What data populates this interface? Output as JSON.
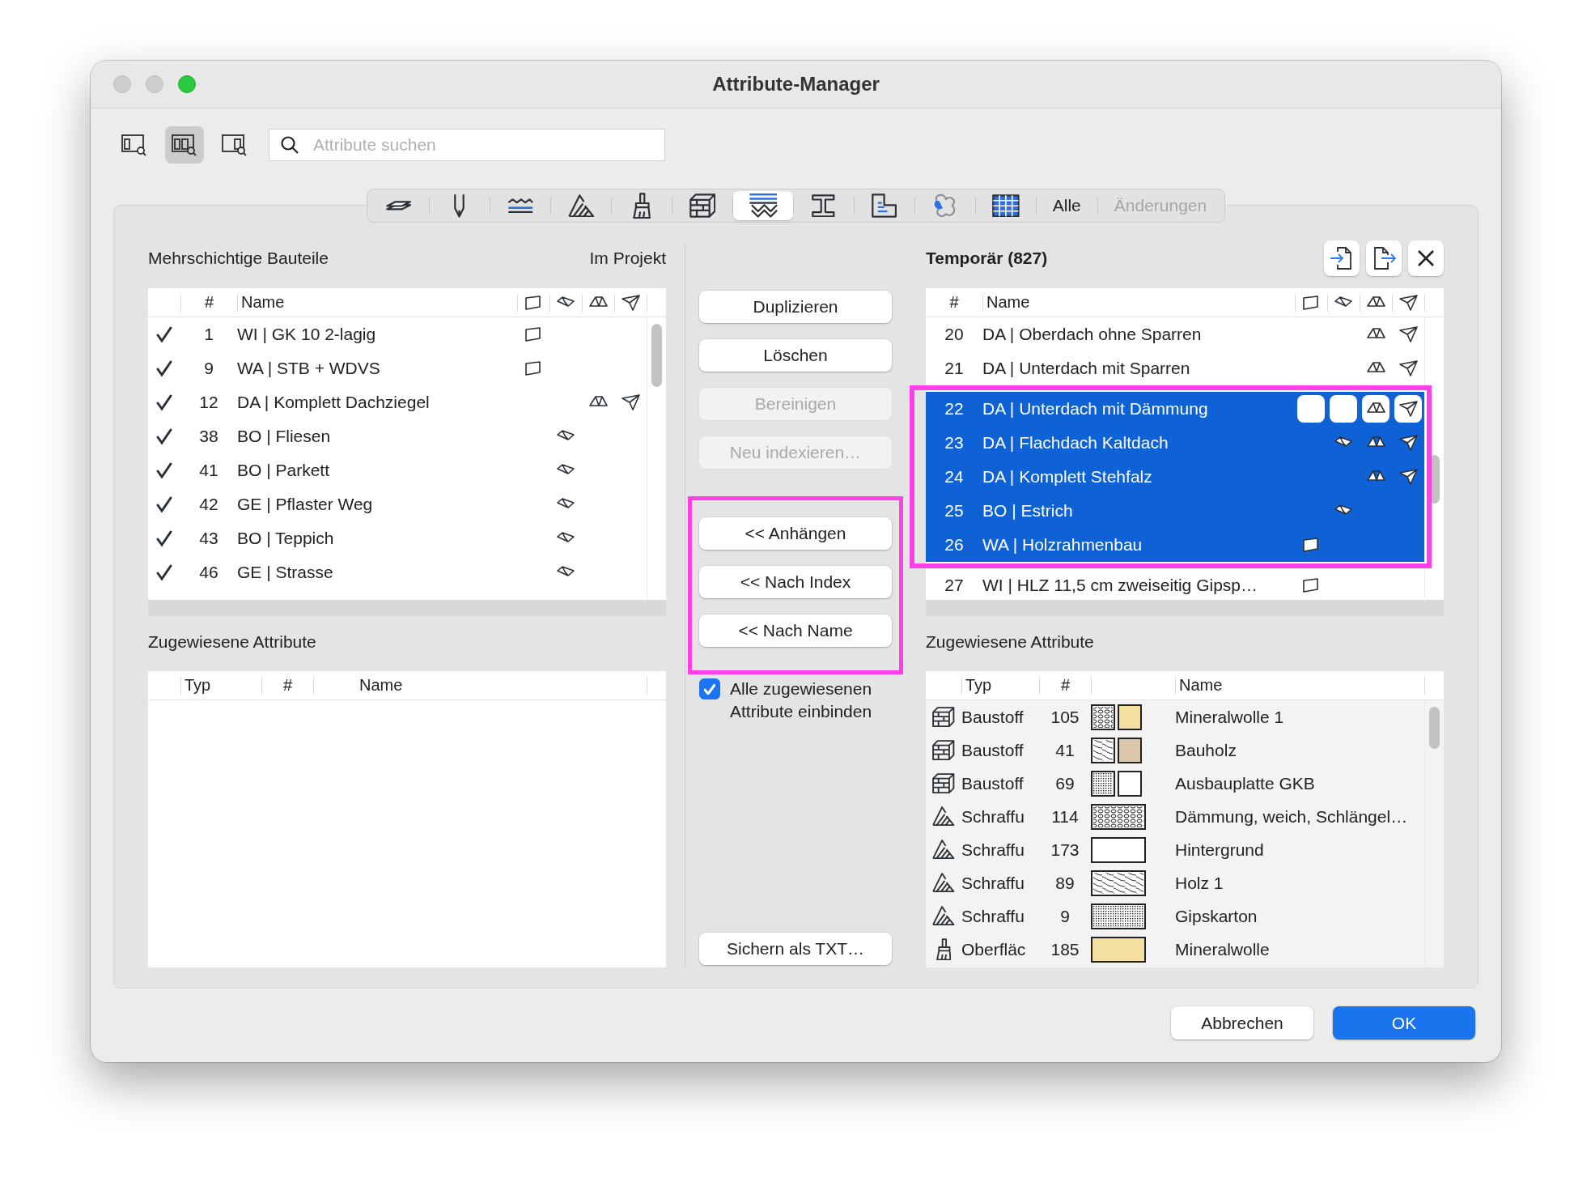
{
  "window": {
    "title": "Attribute-Manager"
  },
  "view_buttons": [
    {
      "kind": "single",
      "selected": false
    },
    {
      "kind": "double",
      "selected": true
    },
    {
      "kind": "right",
      "selected": false
    }
  ],
  "search": {
    "placeholder": "Attribute suchen"
  },
  "type_tabs": [
    {
      "kind": "layers",
      "selected": false
    },
    {
      "kind": "pen",
      "selected": false
    },
    {
      "kind": "lines",
      "selected": false
    },
    {
      "kind": "hatch",
      "selected": false
    },
    {
      "kind": "brush",
      "selected": false
    },
    {
      "kind": "brick",
      "selected": false
    },
    {
      "kind": "layered",
      "selected": true
    },
    {
      "kind": "beam",
      "selected": false
    },
    {
      "kind": "plan",
      "selected": false
    },
    {
      "kind": "blob",
      "selected": false
    },
    {
      "kind": "grid",
      "selected": false
    },
    {
      "kind": "text",
      "label": "Alle",
      "selected": false,
      "disabled": false
    },
    {
      "kind": "text",
      "label": "Änderungen",
      "selected": false,
      "disabled": true
    }
  ],
  "left_panel": {
    "title": "Mehrschichtige Bauteile",
    "scope": "Im Projekt",
    "columns": [
      "#",
      "Name"
    ],
    "rows": [
      {
        "checked": true,
        "number": "1",
        "name": "WI | GK 10 2-lagig",
        "icons": [
          {
            "kind": "wall"
          }
        ]
      },
      {
        "checked": true,
        "number": "9",
        "name": "WA | STB + WDVS",
        "icons": [
          {
            "kind": "wall"
          }
        ]
      },
      {
        "checked": true,
        "number": "12",
        "name": "DA | Komplett Dachziegel",
        "icons": [
          {
            "kind": "roof"
          },
          {
            "kind": "shell"
          }
        ]
      },
      {
        "checked": true,
        "number": "38",
        "name": "BO | Fliesen",
        "icons": [
          {
            "kind": "slab"
          }
        ]
      },
      {
        "checked": true,
        "number": "41",
        "name": "BO | Parkett",
        "icons": [
          {
            "kind": "slab"
          }
        ]
      },
      {
        "checked": true,
        "number": "42",
        "name": "GE | Pflaster Weg",
        "icons": [
          {
            "kind": "slab"
          }
        ]
      },
      {
        "checked": true,
        "number": "43",
        "name": "BO | Teppich",
        "icons": [
          {
            "kind": "slab"
          }
        ]
      },
      {
        "checked": true,
        "number": "46",
        "name": "GE | Strasse",
        "icons": [
          {
            "kind": "slab"
          }
        ]
      }
    ]
  },
  "left_assigned": {
    "title": "Zugewiesene Attribute",
    "columns": [
      "Typ",
      "#",
      "Name"
    ]
  },
  "actions": [
    {
      "label": "Duplizieren",
      "disabled": false
    },
    {
      "label": "Löschen",
      "disabled": false
    },
    {
      "label": "Bereinigen",
      "disabled": true
    },
    {
      "label": "Neu indexieren…",
      "disabled": true
    }
  ],
  "import_actions": {
    "highlighted": true,
    "buttons": [
      {
        "label": "<< Anhängen"
      },
      {
        "label": "<< Nach Index"
      },
      {
        "label": "<< Nach Name"
      }
    ]
  },
  "include_checkbox": {
    "label": "Alle zugewiesenen Attribute einbinden",
    "checked": true
  },
  "save_button": {
    "label": "Sichern als TXT…"
  },
  "right_panel": {
    "title": "Temporär (827)",
    "columns": [
      "#",
      "Name"
    ],
    "highlight_selection": true,
    "rows": [
      {
        "number": "20",
        "name": "DA | Oberdach ohne Sparren",
        "icons": [
          {
            "kind": "roof"
          },
          {
            "kind": "shell"
          }
        ],
        "selected": false,
        "focused": false
      },
      {
        "number": "21",
        "name": "DA | Unterdach mit Sparren",
        "icons": [
          {
            "kind": "roof"
          },
          {
            "kind": "shell"
          }
        ],
        "selected": false,
        "focused": false
      },
      {
        "number": "22",
        "name": "DA | Unterdach mit Dämmung",
        "icons": [
          {
            "kind": "roof"
          },
          {
            "kind": "shell"
          }
        ],
        "selected": true,
        "focused": true
      },
      {
        "number": "23",
        "name": "DA | Flachdach Kaltdach",
        "icons": [
          {
            "kind": "slab"
          },
          {
            "kind": "roof"
          },
          {
            "kind": "shell"
          }
        ],
        "selected": true,
        "focused": false
      },
      {
        "number": "24",
        "name": "DA | Komplett Stehfalz",
        "icons": [
          {
            "kind": "roof"
          },
          {
            "kind": "shell"
          }
        ],
        "selected": true,
        "focused": false
      },
      {
        "number": "25",
        "name": "BO | Estrich",
        "icons": [
          {
            "kind": "slab"
          }
        ],
        "selected": true,
        "focused": false
      },
      {
        "number": "26",
        "name": "WA | Holzrahmenbau",
        "icons": [
          {
            "kind": "wall"
          }
        ],
        "selected": true,
        "focused": false
      },
      {
        "number": "27",
        "name": "WI | HLZ 11,5 cm zweiseitig Gipsp…",
        "icons": [
          {
            "kind": "wall"
          }
        ],
        "selected": false,
        "focused": false
      }
    ]
  },
  "right_assigned": {
    "title": "Zugewiesene Attribute",
    "columns": [
      "Typ",
      "#",
      "Name"
    ],
    "rows": [
      {
        "kind": "material",
        "type": "Baustoff",
        "number": "105",
        "swatches": [
          {
            "kind": "loops"
          },
          {
            "kind": "fill",
            "color": "#f5dfa0"
          }
        ],
        "name": "Mineralwolle 1"
      },
      {
        "kind": "material",
        "type": "Baustoff",
        "number": "41",
        "swatches": [
          {
            "kind": "waves"
          },
          {
            "kind": "fill",
            "color": "#d9c8aa"
          }
        ],
        "name": "Bauholz"
      },
      {
        "kind": "material",
        "type": "Baustoff",
        "number": "69",
        "swatches": [
          {
            "kind": "dots"
          },
          {
            "kind": "fill",
            "color": "#ffffff"
          }
        ],
        "name": "Ausbauplatte GKB"
      },
      {
        "kind": "hatch",
        "type": "Schraffu",
        "number": "114",
        "swatches": [
          {
            "kind": "loops"
          }
        ],
        "name": "Dämmung, weich, Schlängel…"
      },
      {
        "kind": "hatch",
        "type": "Schraffu",
        "number": "173",
        "swatches": [
          {
            "kind": "empty"
          }
        ],
        "name": "Hintergrund"
      },
      {
        "kind": "hatch",
        "type": "Schraffu",
        "number": "89",
        "swatches": [
          {
            "kind": "waves"
          }
        ],
        "name": "Holz 1"
      },
      {
        "kind": "hatch",
        "type": "Schraffu",
        "number": "9",
        "swatches": [
          {
            "kind": "dots"
          }
        ],
        "name": "Gipskarton"
      },
      {
        "kind": "surface",
        "type": "Oberfläc",
        "number": "185",
        "swatches": [
          {
            "kind": "fill",
            "color": "#f5dfa0"
          }
        ],
        "name": "Mineralwolle"
      }
    ]
  },
  "footer": [
    {
      "label": "Abbrechen",
      "primary": false
    },
    {
      "label": "OK",
      "primary": true
    }
  ]
}
